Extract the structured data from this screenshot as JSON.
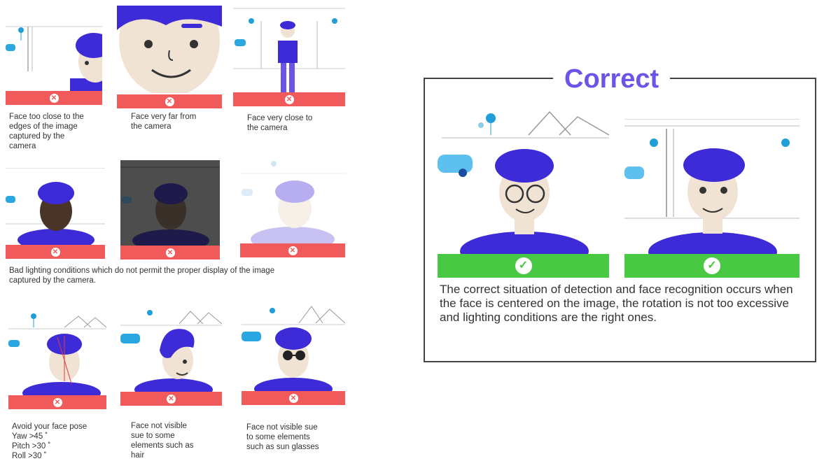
{
  "incorrect_examples": [
    {
      "caption": "Face too close to the\nedges of the image\ncaptured by the\ncamera",
      "status_icon": "close-icon"
    },
    {
      "caption": "Face very far from\nthe camera",
      "status_icon": "close-icon"
    },
    {
      "caption": "Face very close to\nthe camera",
      "status_icon": "close-icon"
    },
    {
      "status_icon": "close-icon"
    },
    {
      "status_icon": "close-icon"
    },
    {
      "status_icon": "close-icon"
    },
    {
      "caption": "Avoid your face pose\nYaw >45 ˚\nPitch >30 ˚\nRoll >30 ˚",
      "status_icon": "close-icon"
    },
    {
      "caption": "Face not visible\nsue to some\nelements  such as\nhair",
      "status_icon": "close-icon"
    },
    {
      "caption": "Face not visible sue\nto some elements\nsuch as sun glasses",
      "status_icon": "close-icon"
    }
  ],
  "lighting_caption": "Bad lighting conditions which do not permit the proper display of the image\ncaptured by the camera.",
  "correct_panel": {
    "title": "Correct",
    "description": "The correct situation of detection and face recognition occurs when the face is centered on the image, the rotation is not too excessive and lighting conditions are the right ones.",
    "examples": [
      {
        "status_icon": "check-icon"
      },
      {
        "status_icon": "check-icon"
      }
    ]
  },
  "colors": {
    "error": "#f15a5a",
    "success": "#48c843",
    "accent": "#6a55e8",
    "hair": "#3c2bd6",
    "skin": "#f1e3d3"
  }
}
